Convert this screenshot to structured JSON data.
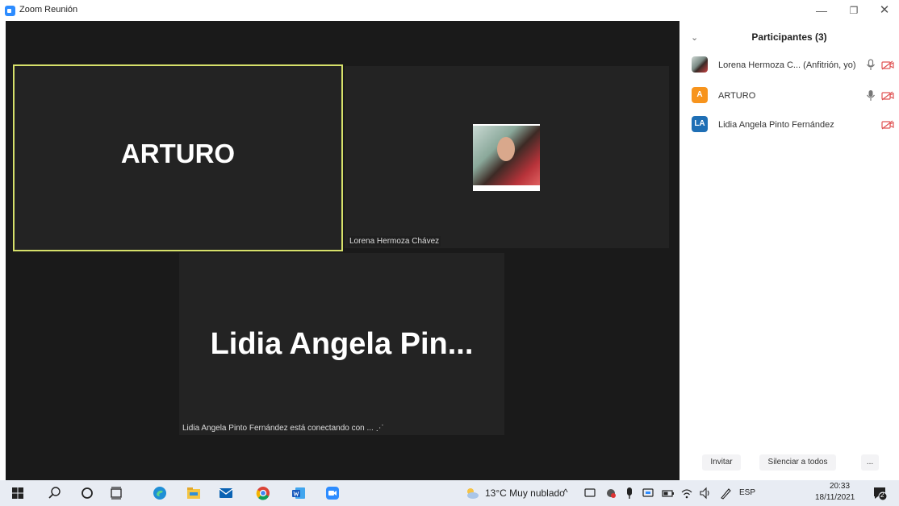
{
  "window": {
    "title": "Zoom Reunión",
    "minimize_glyph": "—",
    "restore_glyph": "❐",
    "close_glyph": "✕"
  },
  "video": {
    "tiles": [
      {
        "name": "ARTURO",
        "active_speaker": true
      },
      {
        "label": "Lorena Hermoza Chávez"
      },
      {
        "name": "Lidia Angela Pin...",
        "status": "Lidia Angela Pinto Fernández está conectando con ...",
        "status_glyph": "⋰"
      }
    ]
  },
  "participants": {
    "collapse_glyph": "⌄",
    "title": "Participantes (3)",
    "list": [
      {
        "initials": "",
        "name": "Lorena Hermoza C...  (Anfitrión, yo)",
        "mic": "on",
        "video": "off"
      },
      {
        "initials": "A",
        "name": "ARTURO",
        "mic": "on",
        "video": "off"
      },
      {
        "initials": "LA",
        "name": "Lidia Angela Pinto Fernández",
        "video": "off"
      }
    ],
    "buttons": {
      "invite": "Invitar",
      "mute_all": "Silenciar a todos",
      "more": "..."
    }
  },
  "taskbar": {
    "weather": "13°C  Muy nublado",
    "tray_up_glyph": "^",
    "language": "ESP",
    "time": "20:33",
    "date": "18/11/2021",
    "notification_count": "2"
  },
  "colors": {
    "active_speaker_border": "#d6e06a",
    "zoom_blue": "#2d8cff",
    "muted_red": "#e05555",
    "taskbar_bg": "#e8ecf3"
  }
}
